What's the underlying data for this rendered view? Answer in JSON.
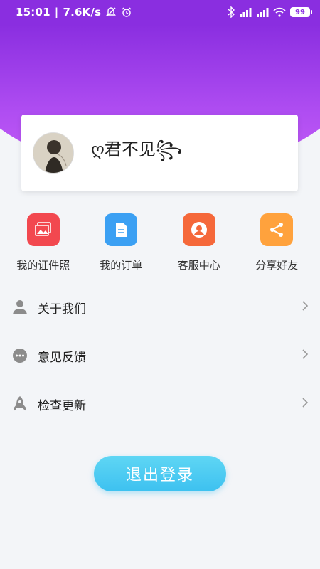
{
  "status_bar": {
    "time": "15:01",
    "net_speed": "7.6K/s",
    "battery": "99"
  },
  "profile": {
    "username": "ღ君不见꧂"
  },
  "quick_actions": [
    {
      "label": "我的证件照",
      "icon": "photo-icon",
      "color": "#f2484f"
    },
    {
      "label": "我的订单",
      "icon": "document-icon",
      "color": "#3ba0f3"
    },
    {
      "label": "客服中心",
      "icon": "headset-icon",
      "color": "#f5683a"
    },
    {
      "label": "分享好友",
      "icon": "share-icon",
      "color": "#ffa23d"
    }
  ],
  "menu": [
    {
      "label": "关于我们",
      "icon": "person-icon"
    },
    {
      "label": "意见反馈",
      "icon": "chat-icon"
    },
    {
      "label": "检查更新",
      "icon": "rocket-icon"
    }
  ],
  "logout_label": "退出登录",
  "colors": {
    "header_purple": "#8a2ee0",
    "button_blue": "#45c8f2"
  }
}
